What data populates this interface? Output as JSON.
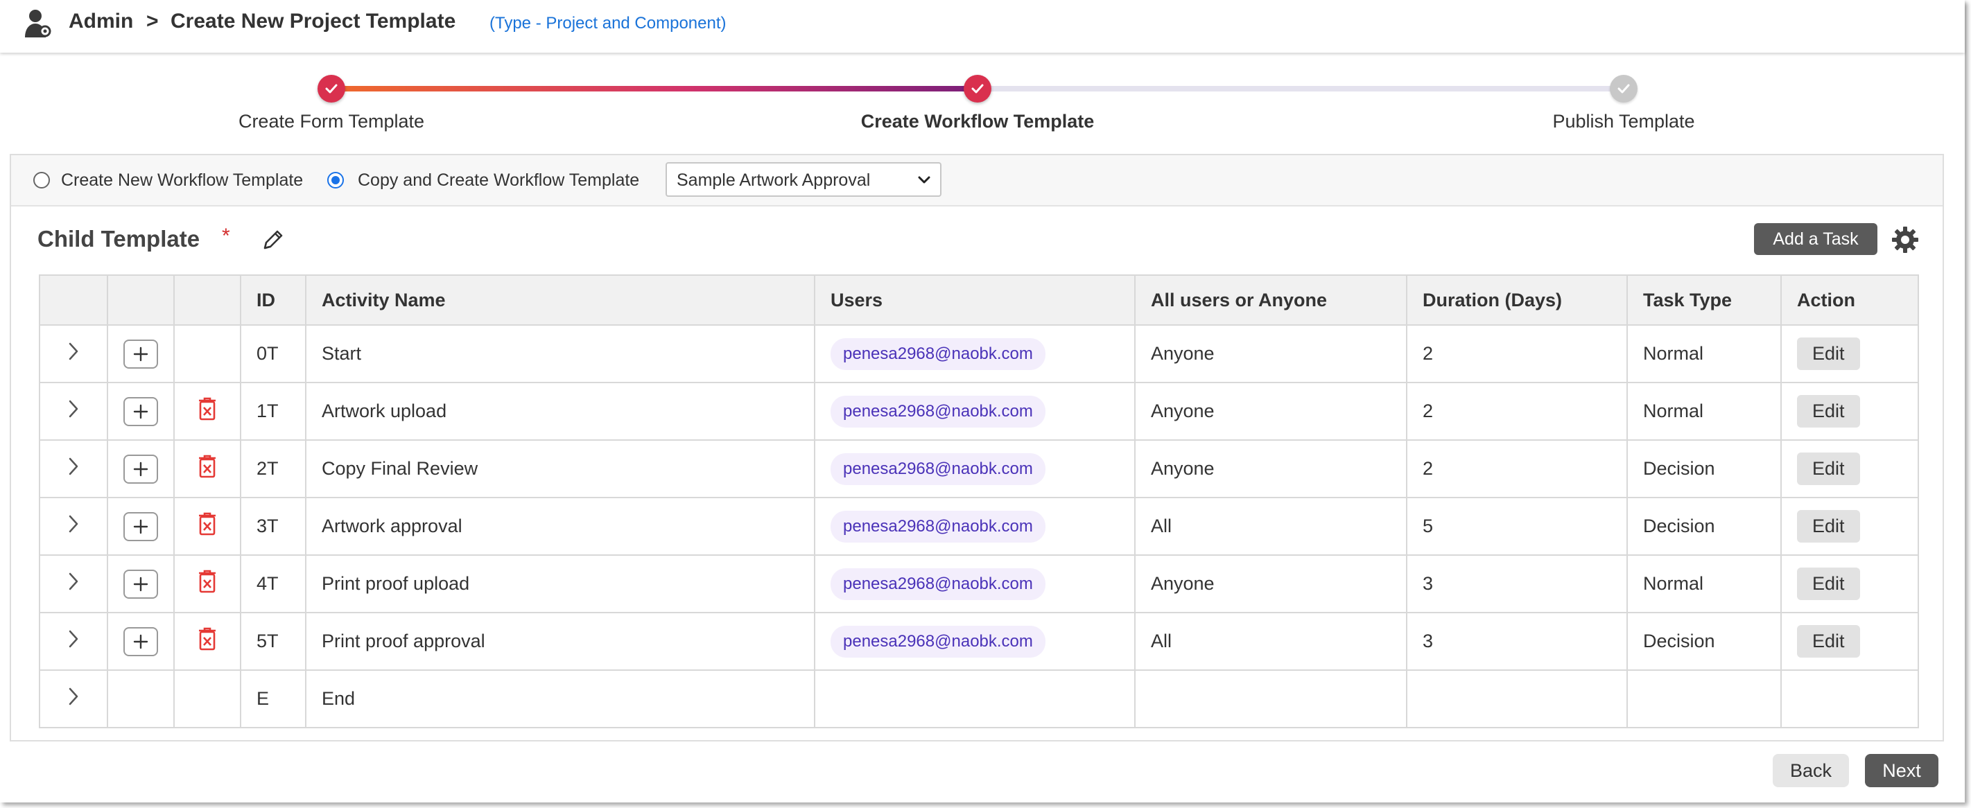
{
  "header": {
    "section": "Admin",
    "separator": ">",
    "title": "Create New Project Template",
    "type_note": "(Type - Project and Component)"
  },
  "stepper": {
    "steps": [
      {
        "label": "Create Form Template",
        "status": "complete"
      },
      {
        "label": "Create Workflow Template",
        "status": "complete",
        "active": true
      },
      {
        "label": "Publish Template",
        "status": "pending"
      }
    ]
  },
  "options": {
    "new_label": "Create New Workflow Template",
    "copy_label": "Copy and Create Workflow Template",
    "selected": "copy",
    "template_select": "Sample Artwork Approval"
  },
  "child_template": {
    "title": "Child Template",
    "required_mark": "*",
    "add_task_label": "Add a Task"
  },
  "table": {
    "headers": [
      "ID",
      "Activity Name",
      "Users",
      "All users or Anyone",
      "Duration (Days)",
      "Task Type",
      "Action"
    ],
    "rows": [
      {
        "id": "0T",
        "activity": "Start",
        "user": "penesa2968@naobk.com",
        "scope": "Anyone",
        "duration": "2",
        "task_type": "Normal",
        "action": "Edit",
        "deletable": false
      },
      {
        "id": "1T",
        "activity": "Artwork upload",
        "user": "penesa2968@naobk.com",
        "scope": "Anyone",
        "duration": "2",
        "task_type": "Normal",
        "action": "Edit",
        "deletable": true
      },
      {
        "id": "2T",
        "activity": "Copy Final Review",
        "user": "penesa2968@naobk.com",
        "scope": "Anyone",
        "duration": "2",
        "task_type": "Decision",
        "action": "Edit",
        "deletable": true
      },
      {
        "id": "3T",
        "activity": "Artwork approval",
        "user": "penesa2968@naobk.com",
        "scope": "All",
        "duration": "5",
        "task_type": "Decision",
        "action": "Edit",
        "deletable": true
      },
      {
        "id": "4T",
        "activity": "Print proof upload",
        "user": "penesa2968@naobk.com",
        "scope": "Anyone",
        "duration": "3",
        "task_type": "Normal",
        "action": "Edit",
        "deletable": true
      },
      {
        "id": "5T",
        "activity": "Print proof approval",
        "user": "penesa2968@naobk.com",
        "scope": "All",
        "duration": "3",
        "task_type": "Decision",
        "action": "Edit",
        "deletable": true
      }
    ],
    "end_row": {
      "id": "E",
      "activity": "End"
    }
  },
  "footer": {
    "back_label": "Back",
    "next_label": "Next"
  },
  "colors": {
    "accent_blue": "#1a73d9",
    "step_done": "#d9304e",
    "delete_red": "#e53935",
    "user_chip_text": "#4a32b8",
    "dark_button": "#595959"
  }
}
